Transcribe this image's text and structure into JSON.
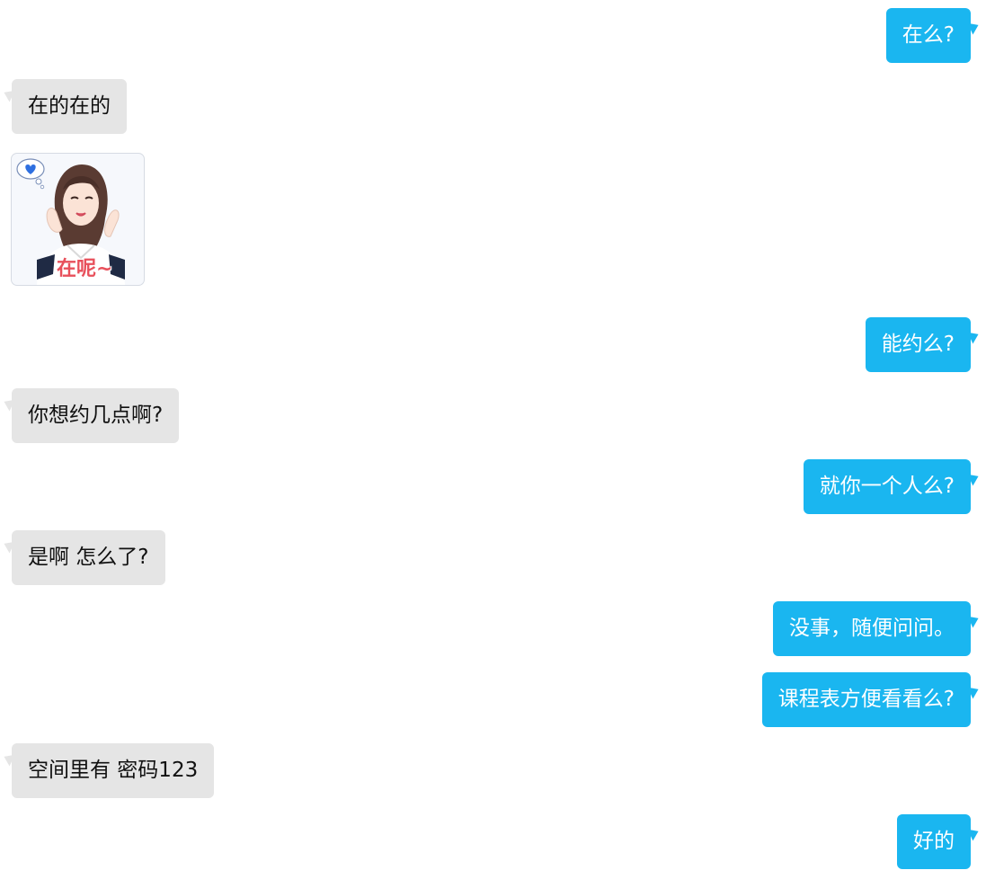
{
  "messages": [
    {
      "side": "sent",
      "text": "在么?"
    },
    {
      "side": "recv",
      "text": "在的在的"
    },
    {
      "side": "recv",
      "type": "sticker",
      "caption": "在呢~"
    },
    {
      "side": "sent",
      "text": "能约么?"
    },
    {
      "side": "recv",
      "text": "你想约几点啊?"
    },
    {
      "side": "sent",
      "text": "就你一个人么?"
    },
    {
      "side": "recv",
      "text": "是啊 怎么了?"
    },
    {
      "side": "sent",
      "text": "没事，随便问问。"
    },
    {
      "side": "sent",
      "text": "课程表方便看看么?"
    },
    {
      "side": "recv",
      "text": "空间里有 密码123"
    },
    {
      "side": "sent",
      "text": "好的"
    }
  ],
  "colors": {
    "sent_bubble": "#1ab6f0",
    "recv_bubble": "#e5e5e5",
    "sent_text": "#ffffff",
    "recv_text": "#111111"
  }
}
